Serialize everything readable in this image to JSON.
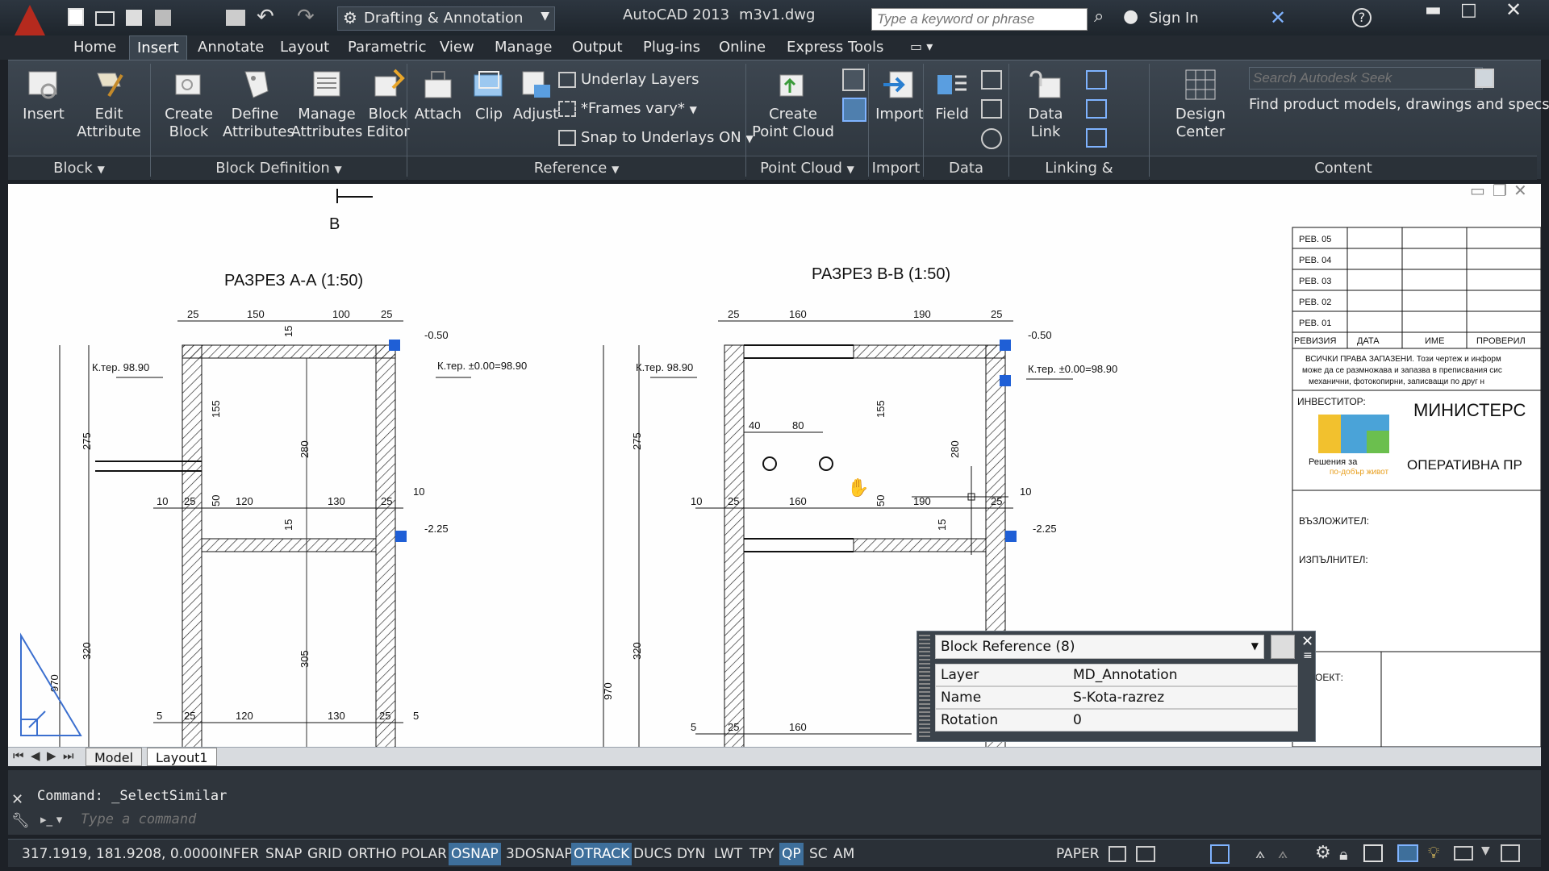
{
  "title_bar": {
    "workspace": "Drafting & Annotation",
    "app_title": "AutoCAD 2013",
    "file_name": "m3v1.dwg",
    "search_placeholder": "Type a keyword or phrase",
    "sign_in": "Sign In"
  },
  "ribbon_tabs": [
    "Home",
    "Insert",
    "Annotate",
    "Layout",
    "Parametric",
    "View",
    "Manage",
    "Output",
    "Plug-ins",
    "Online",
    "Express Tools"
  ],
  "active_tab": "Insert",
  "ribbon": {
    "block": {
      "insert": "Insert",
      "edit_attribute_1": "Edit",
      "edit_attribute_2": "Attribute",
      "label": "Block"
    },
    "block_definition": {
      "create_1": "Create",
      "create_2": "Block",
      "define_1": "Define",
      "define_2": "Attributes",
      "manage_1": "Manage",
      "manage_2": "Attributes",
      "editor_1": "Block",
      "editor_2": "Editor",
      "label": "Block Definition"
    },
    "reference": {
      "attach": "Attach",
      "clip": "Clip",
      "adjust": "Adjust",
      "underlay_layers": "Underlay Layers",
      "frames_vary": "*Frames vary*",
      "snap_underlays": "Snap to Underlays ON",
      "label": "Reference"
    },
    "point_cloud": {
      "create_1": "Create",
      "create_2": "Point Cloud",
      "label": "Point Cloud"
    },
    "import": {
      "import": "Import",
      "label": "Import"
    },
    "data": {
      "field": "Field",
      "label": "Data"
    },
    "linking": {
      "data_link_1": "Data",
      "data_link_2": "Link",
      "label": "Linking & Extraction"
    },
    "content": {
      "design_center": "Design Center",
      "seek_placeholder": "Search Autodesk Seek",
      "seek_desc": "Find product models, drawings and specs",
      "label": "Content"
    }
  },
  "drawing": {
    "section_a": "РАЗРЕЗ А-А (1:50)",
    "section_b": "РАЗРЕЗ В-В (1:50)",
    "marker_b": "B",
    "dims_a_top": [
      "25",
      "150",
      "100",
      "25"
    ],
    "dims_b_top": [
      "25",
      "160",
      "190",
      "25"
    ],
    "dims_a_mid": [
      "10",
      "25",
      "120",
      "130",
      "25"
    ],
    "dims_b_mid": [
      "10",
      "25",
      "160",
      "190",
      "25"
    ],
    "dims_a_bot": [
      "5",
      "25",
      "120",
      "130",
      "25",
      "5"
    ],
    "dims_b_bot": [
      "5",
      "25",
      "160"
    ],
    "level_left_a": "К.тер. 98.90",
    "level_right_a": "К.тер. ±0.00=98.90",
    "level_left_b": "К.тер. 98.90",
    "level_right_b": "К.тер. ±0.00=98.90",
    "elev_top_a": "-0.50",
    "elev_mid_a": "-2.25",
    "elev_top_b": "-0.50",
    "elev_mid_b": "-2.25",
    "vert_a": [
      "275",
      "320",
      "155",
      "280",
      "50",
      "305",
      "15",
      "15",
      "970"
    ],
    "vert_b": [
      "275",
      "320",
      "970",
      "155",
      "280",
      "50",
      "15"
    ],
    "pipe_dims": [
      "40",
      "80"
    ],
    "ten_a": "10",
    "ten_b": "10",
    "title_block": {
      "revisions": [
        "РЕВ. 05",
        "РЕВ. 04",
        "РЕВ. 03",
        "РЕВ. 02",
        "РЕВ. 01"
      ],
      "headers": [
        "РЕВИЗИЯ",
        "ДАТА",
        "ИМЕ",
        "ПРОВЕРИЛ"
      ],
      "notice_1": "ВСИЧКИ ПРАВА ЗАПАЗЕНИ. Този чертеж и информ",
      "notice_2": "може да се размножава и запазва в преписвания сис",
      "notice_3": "механични, фотокопирни, записващи по друг н",
      "investor_label": "ИНВЕСТИТОР:",
      "ministry": "МИНИСТЕРС",
      "operative": "ОПЕРАТИВНА ПР",
      "logo_text_1": "Решения за",
      "logo_text_2": "по-добър живот",
      "assignor": "ВЪЗЛОЖИТЕЛ:",
      "contractor": "ИЗПЪЛНИТЕЛ:",
      "project": "ОЕКТ:"
    }
  },
  "quick_props": {
    "selection": "Block Reference (8)",
    "rows": [
      {
        "key": "Layer",
        "value": "MD_Annotation"
      },
      {
        "key": "Name",
        "value": "S-Kota-razrez"
      },
      {
        "key": "Rotation",
        "value": "0"
      }
    ]
  },
  "layout_tabs": [
    "Model",
    "Layout1"
  ],
  "command": {
    "history": "Command: _SelectSimilar",
    "placeholder": "Type a command"
  },
  "status_bar": {
    "coords": "317.1919, 181.9208, 0.0000",
    "toggles": [
      {
        "label": "INFER",
        "on": false
      },
      {
        "label": "SNAP",
        "on": false
      },
      {
        "label": "GRID",
        "on": false
      },
      {
        "label": "ORTHO",
        "on": false
      },
      {
        "label": "POLAR",
        "on": false
      },
      {
        "label": "OSNAP",
        "on": true
      },
      {
        "label": "3DOSNAP",
        "on": false
      },
      {
        "label": "OTRACK",
        "on": true
      },
      {
        "label": "DUCS",
        "on": false
      },
      {
        "label": "DYN",
        "on": false
      },
      {
        "label": "LWT",
        "on": false
      },
      {
        "label": "TPY",
        "on": false
      },
      {
        "label": "QP",
        "on": true
      },
      {
        "label": "SC",
        "on": false
      },
      {
        "label": "AM",
        "on": false
      }
    ],
    "paper": "PAPER"
  },
  "colors": {
    "grip": "#1f5fd6",
    "accent": "#3e6f9b",
    "title_bg": "#1e252c"
  }
}
